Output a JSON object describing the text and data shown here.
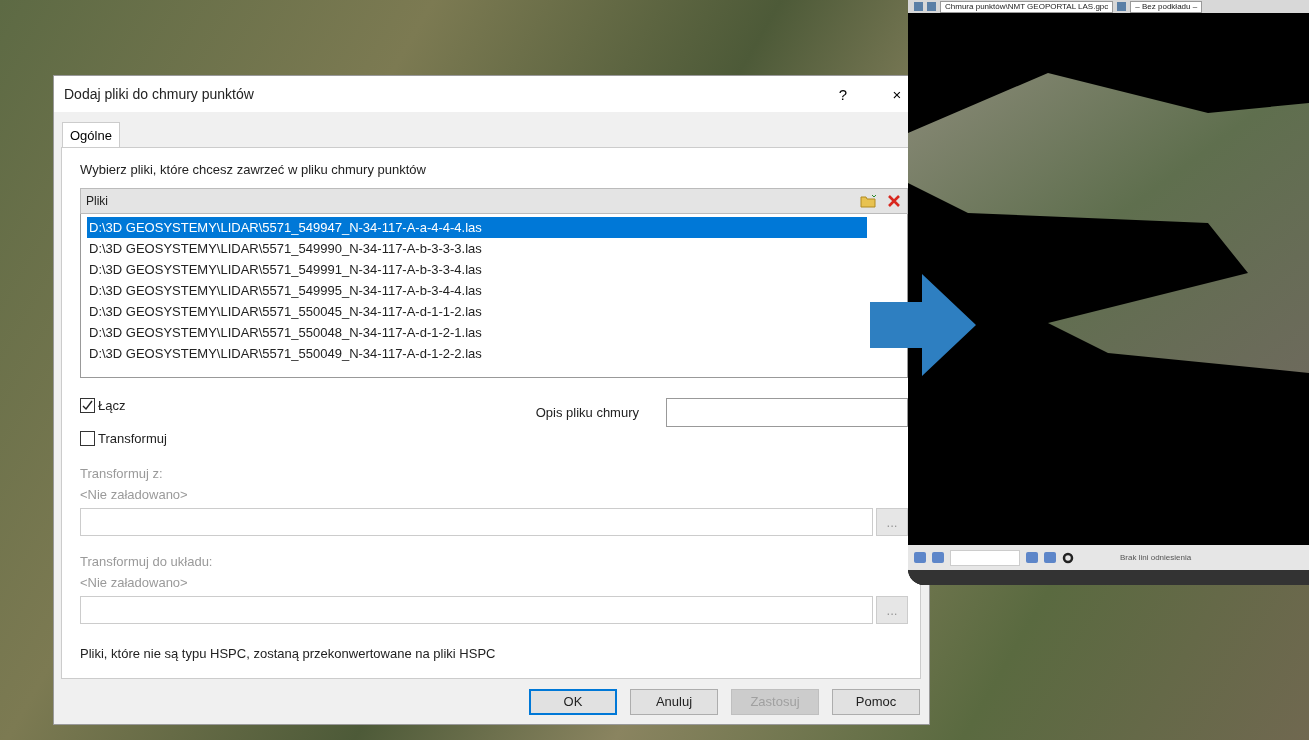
{
  "dialog": {
    "title": "Dodaj pliki do chmury punktów",
    "help": "?",
    "close": "×",
    "tabs": [
      {
        "label": "Ogólne",
        "selected": true
      }
    ],
    "instruction": "Wybierz pliki, które chcesz zawrzeć w pliku chmury punktów",
    "files": {
      "header": "Pliki",
      "items": [
        {
          "path": "D:\\3D GEOSYSTEMY\\LIDAR\\5571_549947_N-34-117-A-a-4-4-4.las",
          "selected": true
        },
        {
          "path": "D:\\3D GEOSYSTEMY\\LIDAR\\5571_549990_N-34-117-A-b-3-3-3.las",
          "selected": false
        },
        {
          "path": "D:\\3D GEOSYSTEMY\\LIDAR\\5571_549991_N-34-117-A-b-3-3-4.las",
          "selected": false
        },
        {
          "path": "D:\\3D GEOSYSTEMY\\LIDAR\\5571_549995_N-34-117-A-b-3-4-4.las",
          "selected": false
        },
        {
          "path": "D:\\3D GEOSYSTEMY\\LIDAR\\5571_550045_N-34-117-A-d-1-1-2.las",
          "selected": false
        },
        {
          "path": "D:\\3D GEOSYSTEMY\\LIDAR\\5571_550048_N-34-117-A-d-1-2-1.las",
          "selected": false
        },
        {
          "path": "D:\\3D GEOSYSTEMY\\LIDAR\\5571_550049_N-34-117-A-d-1-2-2.las",
          "selected": false
        }
      ]
    },
    "merge": {
      "label": "Łącz",
      "checked": true
    },
    "description_label": "Opis pliku chmury",
    "transform": {
      "label": "Transformuj",
      "checked": false
    },
    "transform_fields": [
      {
        "label": "Transformuj z:",
        "value": "<Nie załadowano>",
        "browse": "...",
        "disabled": true
      },
      {
        "label": "Transformuj do układu:",
        "value": "<Nie załadowano>",
        "browse": "...",
        "disabled": true
      }
    ],
    "note": "Pliki, które nie są typu HSPC, zostaną przekonwertowane na pliki HSPC",
    "buttons": [
      {
        "label": "OK",
        "kind": "default"
      },
      {
        "label": "Anuluj",
        "kind": "normal"
      },
      {
        "label": "Zastosuj",
        "kind": "disabled"
      },
      {
        "label": "Pomoc",
        "kind": "normal"
      }
    ]
  },
  "viewer": {
    "document": "Chmura punktów\\NMT GEOPORTAL LAS.gpc",
    "background": "– Bez podkładu –",
    "status": "Brak lini odniesienia"
  }
}
